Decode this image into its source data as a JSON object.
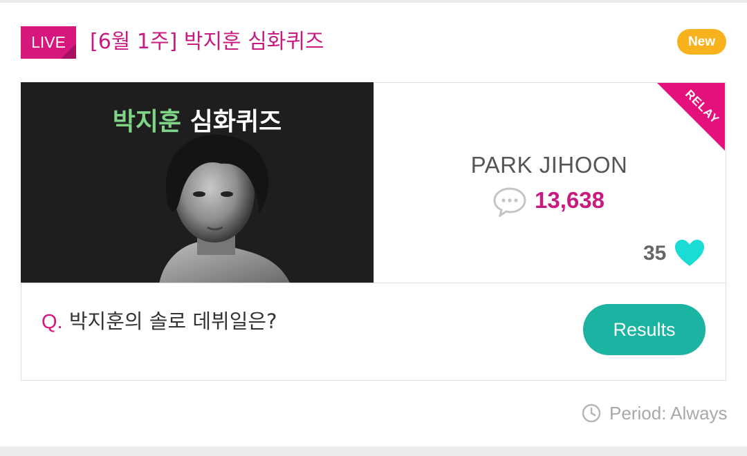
{
  "header": {
    "live_label": "LIVE",
    "title": "[6월 1주] 박지훈 심화퀴즈",
    "new_label": "New"
  },
  "thumbnail": {
    "title_name": "박지훈",
    "title_rest": "심화퀴즈"
  },
  "ribbon": {
    "label": "RELAY"
  },
  "info": {
    "artist": "PARK JIHOON",
    "comment_count": "13,638",
    "like_count": "35"
  },
  "question": {
    "prefix": "Q.",
    "text": "박지훈의 솔로 데뷔일은?"
  },
  "actions": {
    "results_label": "Results"
  },
  "footer": {
    "period": "Period: Always"
  },
  "colors": {
    "brand_pink": "#d6177e",
    "new_badge": "#f7b21e",
    "results_button": "#1bb3a1",
    "heart": "#19dcd4",
    "thumb_green": "#7fd488"
  },
  "icons": [
    "comment-icon",
    "heart-icon",
    "clock-icon"
  ]
}
